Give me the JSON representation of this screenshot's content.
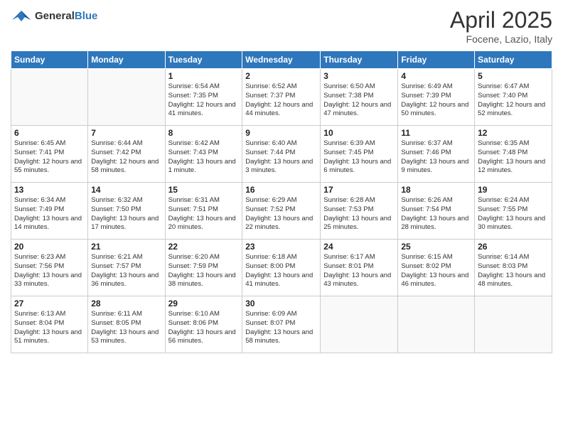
{
  "header": {
    "logo_general": "General",
    "logo_blue": "Blue",
    "title": "April 2025",
    "subtitle": "Focene, Lazio, Italy"
  },
  "days_of_week": [
    "Sunday",
    "Monday",
    "Tuesday",
    "Wednesday",
    "Thursday",
    "Friday",
    "Saturday"
  ],
  "weeks": [
    [
      {
        "day": "",
        "info": ""
      },
      {
        "day": "",
        "info": ""
      },
      {
        "day": "1",
        "info": "Sunrise: 6:54 AM\nSunset: 7:35 PM\nDaylight: 12 hours and 41 minutes."
      },
      {
        "day": "2",
        "info": "Sunrise: 6:52 AM\nSunset: 7:37 PM\nDaylight: 12 hours and 44 minutes."
      },
      {
        "day": "3",
        "info": "Sunrise: 6:50 AM\nSunset: 7:38 PM\nDaylight: 12 hours and 47 minutes."
      },
      {
        "day": "4",
        "info": "Sunrise: 6:49 AM\nSunset: 7:39 PM\nDaylight: 12 hours and 50 minutes."
      },
      {
        "day": "5",
        "info": "Sunrise: 6:47 AM\nSunset: 7:40 PM\nDaylight: 12 hours and 52 minutes."
      }
    ],
    [
      {
        "day": "6",
        "info": "Sunrise: 6:45 AM\nSunset: 7:41 PM\nDaylight: 12 hours and 55 minutes."
      },
      {
        "day": "7",
        "info": "Sunrise: 6:44 AM\nSunset: 7:42 PM\nDaylight: 12 hours and 58 minutes."
      },
      {
        "day": "8",
        "info": "Sunrise: 6:42 AM\nSunset: 7:43 PM\nDaylight: 13 hours and 1 minute."
      },
      {
        "day": "9",
        "info": "Sunrise: 6:40 AM\nSunset: 7:44 PM\nDaylight: 13 hours and 3 minutes."
      },
      {
        "day": "10",
        "info": "Sunrise: 6:39 AM\nSunset: 7:45 PM\nDaylight: 13 hours and 6 minutes."
      },
      {
        "day": "11",
        "info": "Sunrise: 6:37 AM\nSunset: 7:46 PM\nDaylight: 13 hours and 9 minutes."
      },
      {
        "day": "12",
        "info": "Sunrise: 6:35 AM\nSunset: 7:48 PM\nDaylight: 13 hours and 12 minutes."
      }
    ],
    [
      {
        "day": "13",
        "info": "Sunrise: 6:34 AM\nSunset: 7:49 PM\nDaylight: 13 hours and 14 minutes."
      },
      {
        "day": "14",
        "info": "Sunrise: 6:32 AM\nSunset: 7:50 PM\nDaylight: 13 hours and 17 minutes."
      },
      {
        "day": "15",
        "info": "Sunrise: 6:31 AM\nSunset: 7:51 PM\nDaylight: 13 hours and 20 minutes."
      },
      {
        "day": "16",
        "info": "Sunrise: 6:29 AM\nSunset: 7:52 PM\nDaylight: 13 hours and 22 minutes."
      },
      {
        "day": "17",
        "info": "Sunrise: 6:28 AM\nSunset: 7:53 PM\nDaylight: 13 hours and 25 minutes."
      },
      {
        "day": "18",
        "info": "Sunrise: 6:26 AM\nSunset: 7:54 PM\nDaylight: 13 hours and 28 minutes."
      },
      {
        "day": "19",
        "info": "Sunrise: 6:24 AM\nSunset: 7:55 PM\nDaylight: 13 hours and 30 minutes."
      }
    ],
    [
      {
        "day": "20",
        "info": "Sunrise: 6:23 AM\nSunset: 7:56 PM\nDaylight: 13 hours and 33 minutes."
      },
      {
        "day": "21",
        "info": "Sunrise: 6:21 AM\nSunset: 7:57 PM\nDaylight: 13 hours and 36 minutes."
      },
      {
        "day": "22",
        "info": "Sunrise: 6:20 AM\nSunset: 7:59 PM\nDaylight: 13 hours and 38 minutes."
      },
      {
        "day": "23",
        "info": "Sunrise: 6:18 AM\nSunset: 8:00 PM\nDaylight: 13 hours and 41 minutes."
      },
      {
        "day": "24",
        "info": "Sunrise: 6:17 AM\nSunset: 8:01 PM\nDaylight: 13 hours and 43 minutes."
      },
      {
        "day": "25",
        "info": "Sunrise: 6:15 AM\nSunset: 8:02 PM\nDaylight: 13 hours and 46 minutes."
      },
      {
        "day": "26",
        "info": "Sunrise: 6:14 AM\nSunset: 8:03 PM\nDaylight: 13 hours and 48 minutes."
      }
    ],
    [
      {
        "day": "27",
        "info": "Sunrise: 6:13 AM\nSunset: 8:04 PM\nDaylight: 13 hours and 51 minutes."
      },
      {
        "day": "28",
        "info": "Sunrise: 6:11 AM\nSunset: 8:05 PM\nDaylight: 13 hours and 53 minutes."
      },
      {
        "day": "29",
        "info": "Sunrise: 6:10 AM\nSunset: 8:06 PM\nDaylight: 13 hours and 56 minutes."
      },
      {
        "day": "30",
        "info": "Sunrise: 6:09 AM\nSunset: 8:07 PM\nDaylight: 13 hours and 58 minutes."
      },
      {
        "day": "",
        "info": ""
      },
      {
        "day": "",
        "info": ""
      },
      {
        "day": "",
        "info": ""
      }
    ]
  ]
}
